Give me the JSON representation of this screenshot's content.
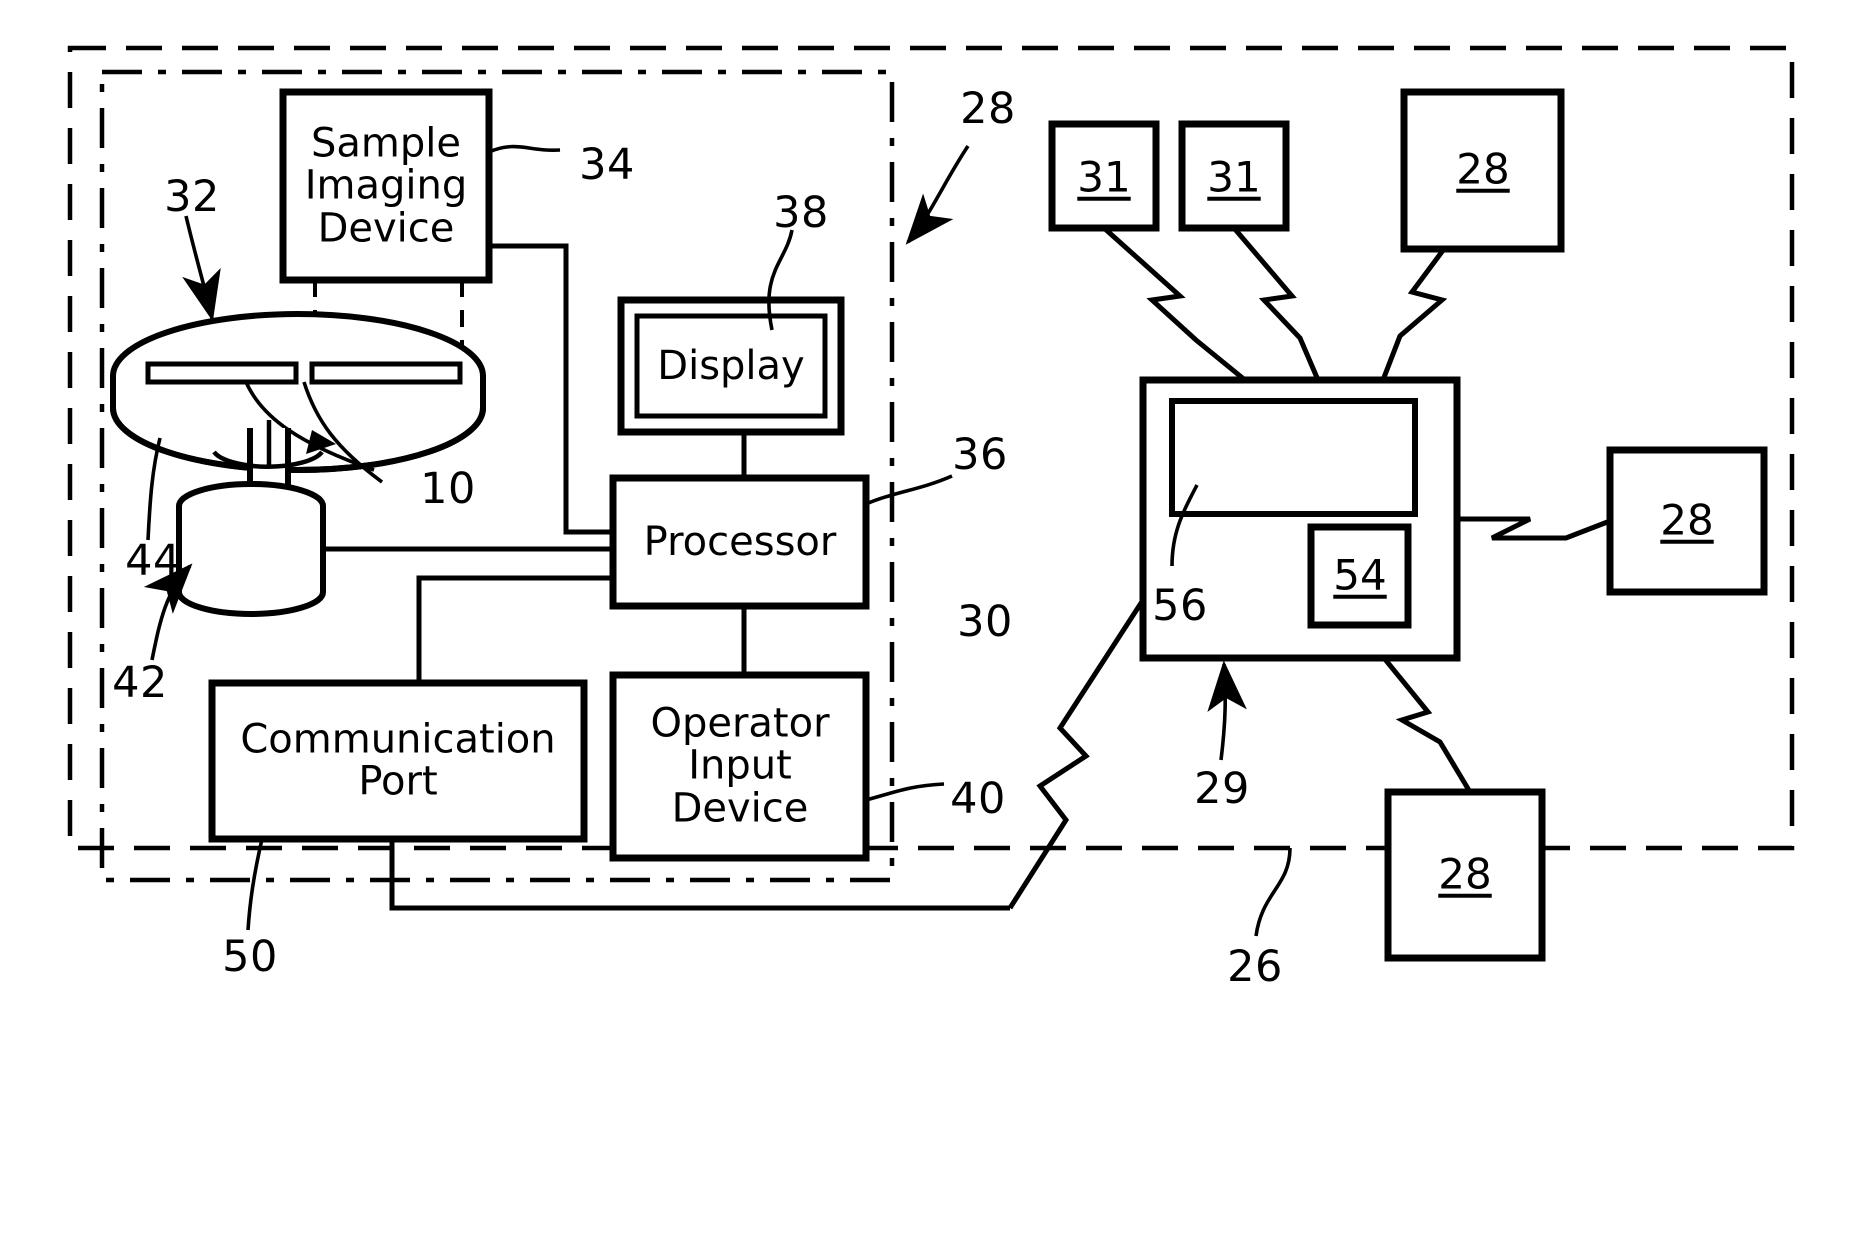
{
  "figure": {
    "type": "patent-block-diagram",
    "title": "Slide imaging system and network",
    "background": "#ffffff",
    "line_color": "#000000"
  },
  "blocks": {
    "sample_imaging_device": {
      "label": "Sample\nImaging\nDevice",
      "ref": "34"
    },
    "display": {
      "label": "Display",
      "ref": "38"
    },
    "processor": {
      "label": "Processor",
      "ref": "36"
    },
    "operator_input_device": {
      "label": "Operator\nInput\nDevice",
      "ref": "40"
    },
    "communication_port": {
      "label": "Communication\nPort",
      "ref": "50"
    }
  },
  "components": {
    "carousel": {
      "ref": "32"
    },
    "slides": {
      "ref": "10"
    },
    "platter": {
      "ref": "44"
    },
    "motor": {
      "ref": "42"
    },
    "workstation_boundary": {
      "ref": "30"
    },
    "network_boundary": {
      "ref": "26"
    },
    "server": {
      "ref": "29"
    },
    "server_memory": {
      "ref": "56"
    },
    "server_module": {
      "ref": "54"
    },
    "system_pointer": {
      "ref": "28"
    }
  },
  "nodes": [
    {
      "name": "client-node-31-a",
      "value": "31"
    },
    {
      "name": "client-node-31-b",
      "value": "31"
    },
    {
      "name": "client-node-28-top",
      "value": "28"
    },
    {
      "name": "client-node-28-right",
      "value": "28"
    },
    {
      "name": "client-node-28-bottom",
      "value": "28"
    }
  ],
  "reference_numerals": {
    "n10": "10",
    "n26": "26",
    "n28": "28",
    "n29": "29",
    "n30": "30",
    "n31": "31",
    "n32": "32",
    "n34": "34",
    "n36": "36",
    "n38": "38",
    "n40": "40",
    "n42": "42",
    "n44": "44",
    "n50": "50",
    "n54": "54",
    "n56": "56"
  }
}
